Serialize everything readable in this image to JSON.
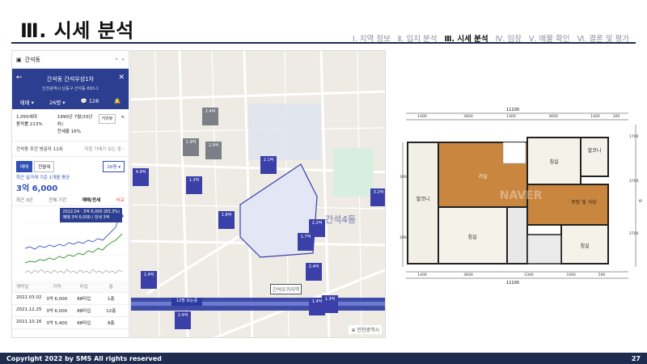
{
  "slide": {
    "title": "Ⅲ. 시세 분석",
    "nav": [
      "Ⅰ. 지역 정보",
      "Ⅱ. 입지 분석",
      "Ⅲ. 시세 분석",
      "Ⅳ. 임장",
      "Ⅴ. 매물 확인",
      "Ⅵ. 결론 및 평가"
    ],
    "active_nav_index": 2,
    "footer_left": "Copyright 2022 by SMS All rights reserved",
    "page_number": "27"
  },
  "phone": {
    "search_value": "간석동",
    "apt_name": "간석동 간석우성1차",
    "apt_address": "인천광역시 남동구 간석동 893-1",
    "deal_type": "매매",
    "size": "26평",
    "comments": "128",
    "households": "1,050세대",
    "floor_ratio": "용적률 213%",
    "built": "1990년 7월(33년차)",
    "lease_ratio": "전세율 16%",
    "distance_btn": "거리뷰",
    "rank_text": "간석동 주간 방문자 11위",
    "rank_link": "직접 거래가 보는 중 ›",
    "tab_sale": "매매",
    "tab_lease": "전월세",
    "size_select": "26평 ▾",
    "price_label": "최근 실거래 기준 1개월 평균",
    "price_value": "3억 6,000",
    "subtabs": [
      "최근 3년",
      "전체 기간",
      "매매/전세",
      "비교"
    ],
    "tooltip_line1": "2022.04 · 3억 6,000 (83.3%)",
    "tooltip_line2": "매매 3억 6,000 / 전세 3억",
    "table_header": [
      "계약일",
      "가격",
      "타입",
      "층"
    ],
    "table_rows": [
      [
        "2022.03.02",
        "3억 6,000",
        "88타입",
        "1층"
      ],
      [
        "2021.12.25",
        "3억 6,000",
        "88타입",
        "12층"
      ],
      [
        "2021.10.16",
        "3억 5,400",
        "88타입",
        "8층"
      ]
    ]
  },
  "map": {
    "area_label": "간석4동",
    "station": "간석오거리역",
    "markers": [
      {
        "label": "1.4억",
        "gray": false
      },
      {
        "label": "2.4억",
        "gray": true
      },
      {
        "label": "1.9억",
        "gray": true
      },
      {
        "label": "1.9억",
        "gray": true
      },
      {
        "label": "4.9억",
        "gray": false
      },
      {
        "label": "1.3억",
        "gray": false
      },
      {
        "label": "1.8억",
        "gray": false
      },
      {
        "label": "2.1억",
        "gray": false
      },
      {
        "label": "2.2억",
        "gray": false
      },
      {
        "label": "1.7억",
        "gray": false
      },
      {
        "label": "3.2억",
        "gray": false
      },
      {
        "label": "2.4억",
        "gray": false
      },
      {
        "label": "1.4억",
        "gray": false
      },
      {
        "label": "1.3억",
        "gray": false
      },
      {
        "label": "2.4억",
        "gray": false
      },
      {
        "label": "12명 보는중",
        "gray": false
      }
    ]
  },
  "plan": {
    "total_width": "11100",
    "top_dims": [
      "1400",
      "3600",
      "1400",
      "3600",
      "1400",
      "300"
    ],
    "bottom_dims": [
      "1400",
      "3600",
      "2300",
      "3300",
      "500"
    ],
    "right_dims": [
      "1700",
      "2700",
      "2700"
    ],
    "left_dims": [
      "3000",
      "3900"
    ],
    "side_total": "6900",
    "rooms": [
      {
        "name": "발코니"
      },
      {
        "name": "거실"
      },
      {
        "name": "침실"
      },
      {
        "name": "발코니"
      },
      {
        "name": "주방 및\n식당"
      },
      {
        "name": "침실"
      },
      {
        "name": "침실"
      }
    ],
    "watermark": "NAVER"
  }
}
